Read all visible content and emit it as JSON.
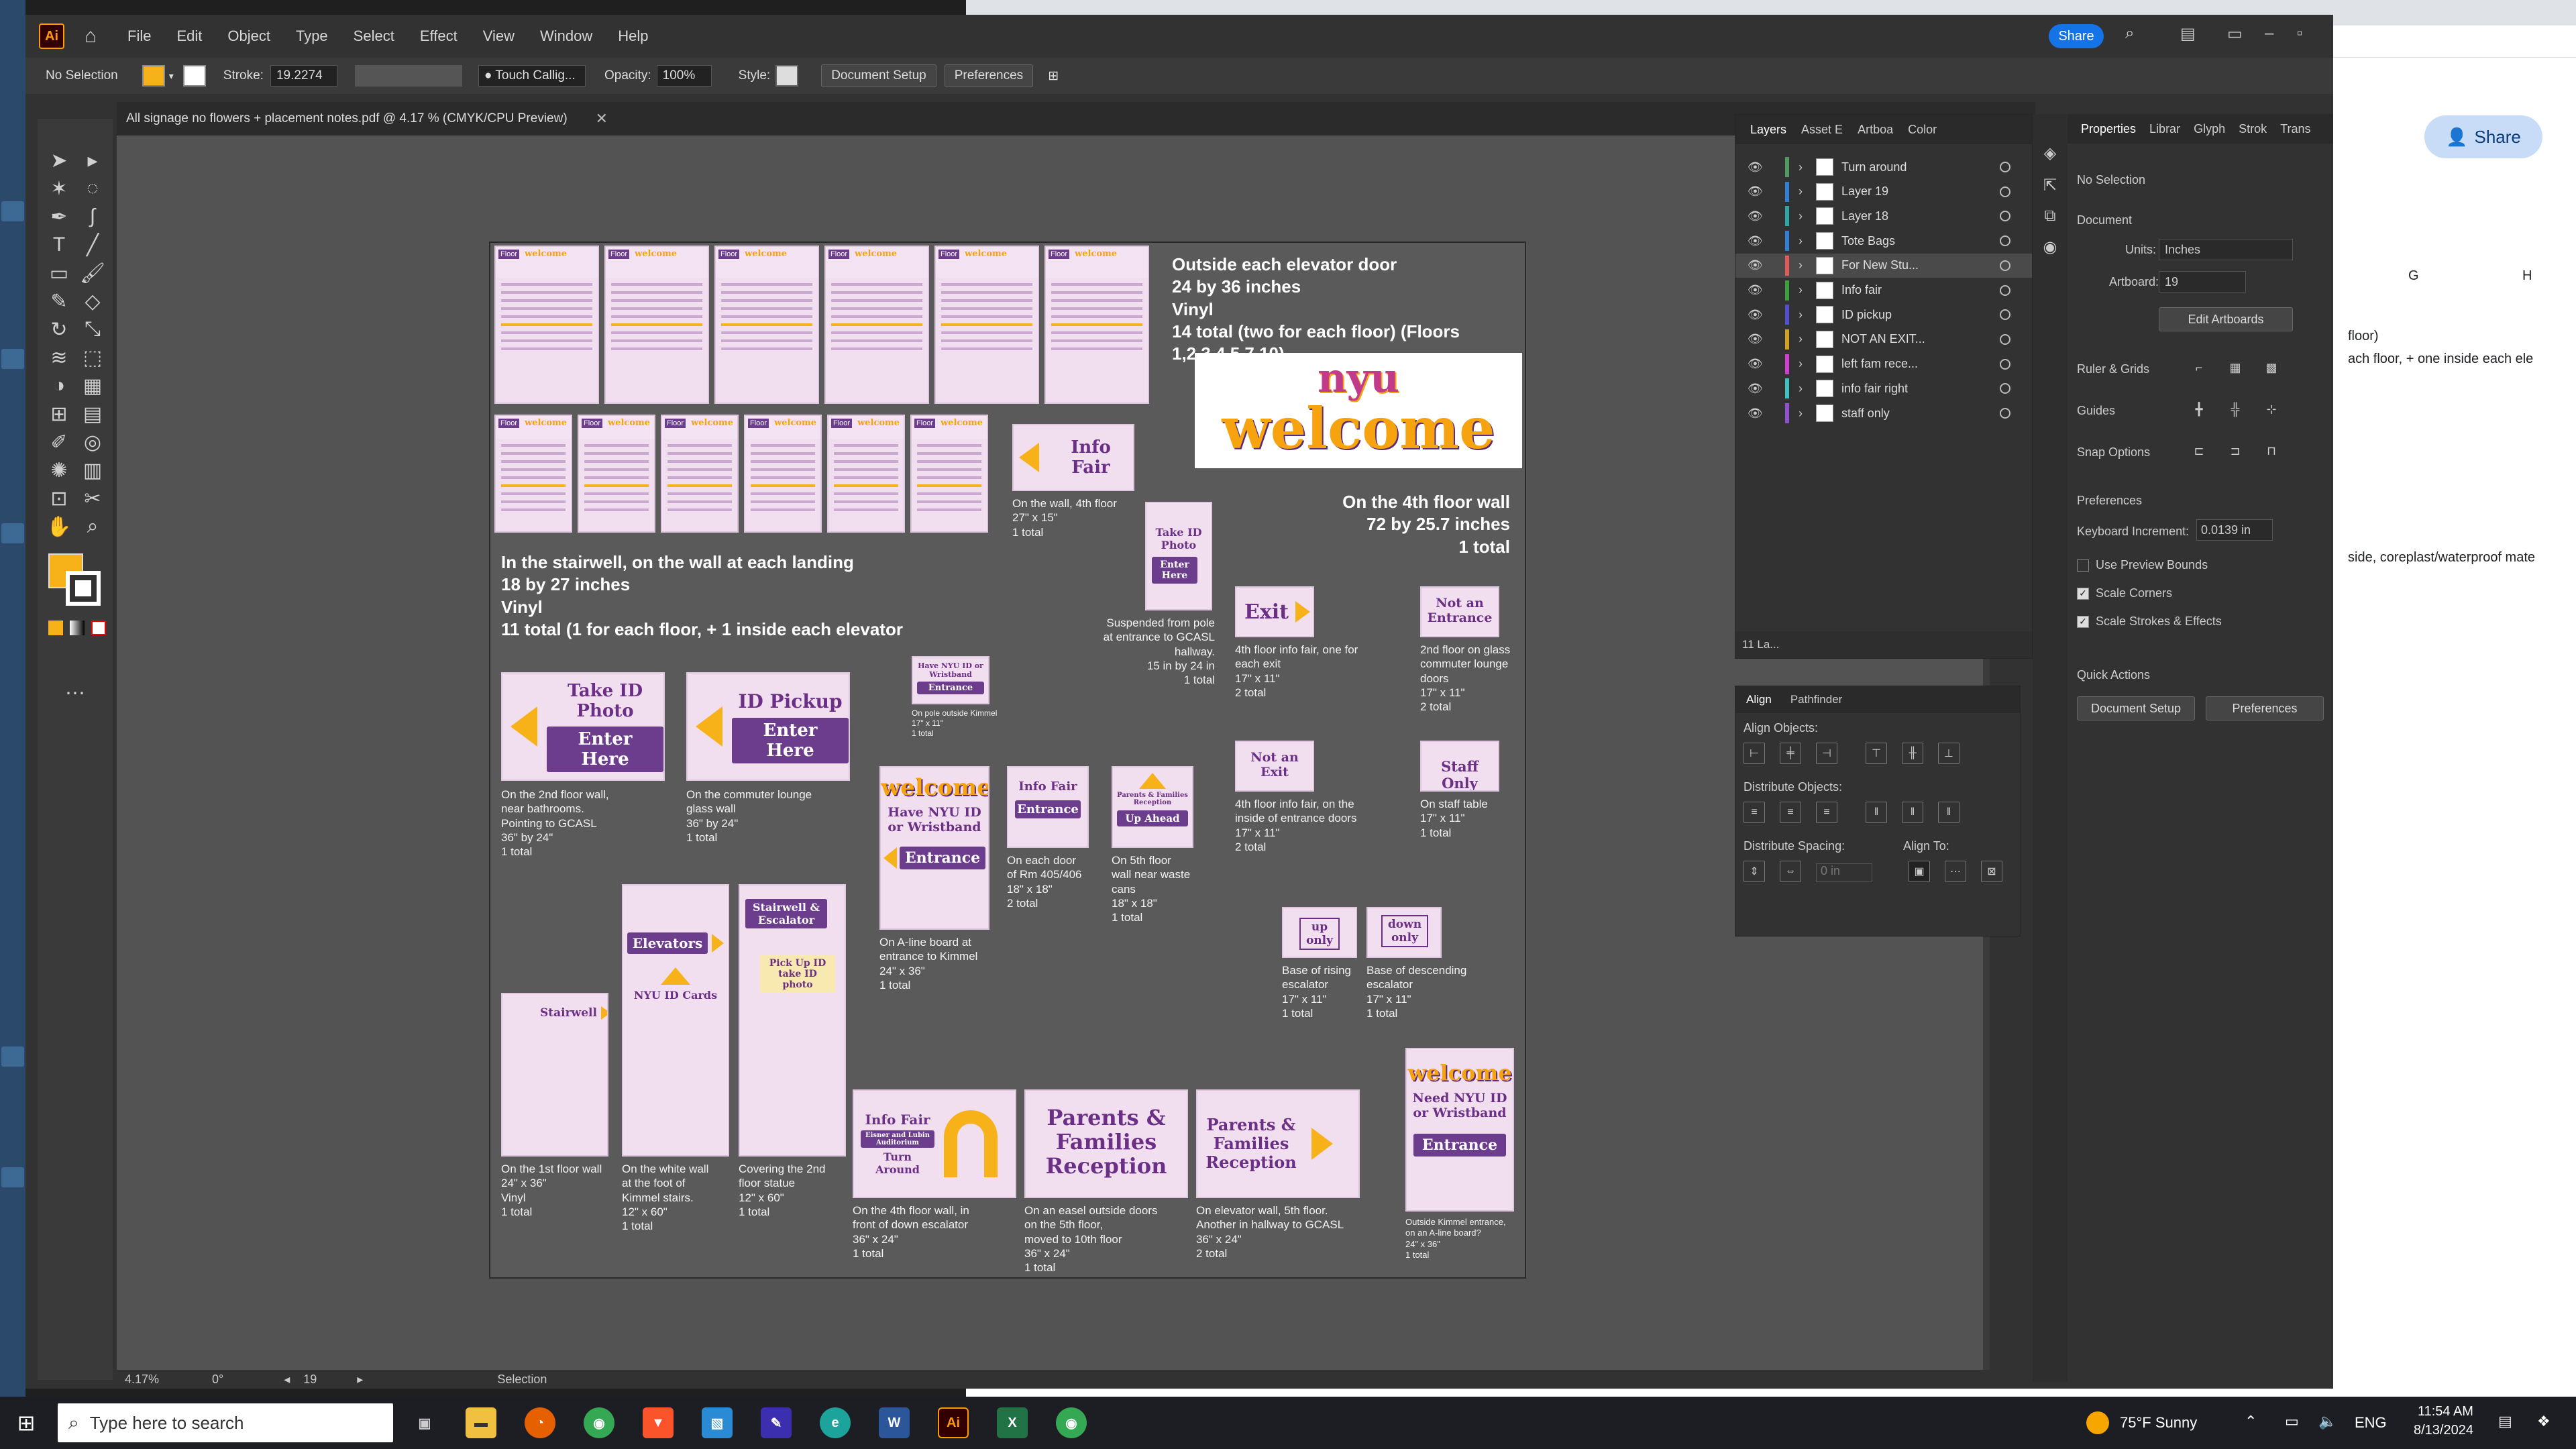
{
  "window": {
    "title": "All signage no flowers + placement notes.pdf @ 4.17 % (CMYK/CPU Preview)",
    "app_logo": "Ai",
    "share": "Share"
  },
  "menu": [
    "File",
    "Edit",
    "Object",
    "Type",
    "Select",
    "Effect",
    "View",
    "Window",
    "Help"
  ],
  "control": {
    "selection": "No Selection",
    "stroke_label": "Stroke:",
    "stroke_value": "19.2274",
    "brush": "Touch Callig...",
    "opacity_label": "Opacity:",
    "opacity_value": "100%",
    "style_label": "Style:",
    "doc_setup": "Document Setup",
    "preferences": "Preferences"
  },
  "status": {
    "zoom": "4.17%",
    "rotation": "0°",
    "artboard": "19",
    "tool": "Selection"
  },
  "artboard": {
    "elevator_note": [
      "Outside each elevator door",
      "24 by 36 inches",
      "Vinyl",
      "14 total (two for each floor) (Floors 1,2,3,4,5,7,10)"
    ],
    "stairwell_note": [
      "In the stairwell, on the wall at each landing",
      "18 by 27 inches",
      "Vinyl",
      "11 total (1 for each floor, + 1 inside each elevator"
    ],
    "fourth_floor_note": [
      "On the 4th floor wall",
      "72 by 25.7 inches",
      "1 total"
    ],
    "welcome_logo": [
      "nyu",
      "welcome"
    ],
    "floor_tile": "Floor",
    "signs": {
      "info_fair": "Info Fair",
      "take_id_photo": "Take ID Photo",
      "enter_here": "Enter Here",
      "id_pickup": "ID Pickup",
      "exit": "Exit",
      "not_an_entrance": "Not an Entrance",
      "not_an_exit": "Not an Exit",
      "staff_only": "Staff Only",
      "have_nyu_id": "Have NYU ID or Wristband",
      "entrance": "Entrance",
      "parents_up": "Parents & Families Reception",
      "up_ahead": "Up Ahead",
      "up_only": "up only",
      "down_only": "down only",
      "elevators": "Elevators",
      "nyu_id_cards": "NYU ID Cards",
      "stairwell": "Stairwell",
      "stairwell_escalator": "Stairwell & Escalator",
      "pick_up_id": "Pick Up ID",
      "take_id_photo_small": "take ID photo",
      "info_fair_turn": "Info Fair",
      "kimmel_aud": "Eisner and Lubin Auditorium",
      "turn_around": "Turn Around",
      "parents_families": "Parents & Families Reception",
      "need_nyu_id": "Need NYU ID or Wristband"
    },
    "notes": {
      "info_fair": [
        "On the wall, 4th floor",
        "27\" x 15\"",
        "1 total"
      ],
      "take_id_pole": [
        "Suspended from pole",
        "at entrance to GCASL",
        "hallway.",
        "15 in by 24 in",
        "1 total"
      ],
      "exit": [
        "4th floor info fair, one for",
        "each exit",
        "17\" x 11\"",
        "2 total"
      ],
      "not_entrance": [
        "2nd floor on glass",
        "commuter lounge",
        "doors",
        "17\" x 11\"",
        "2 total"
      ],
      "pole_kimmel": [
        "On pole outside Kimmel",
        "17\" x 11\"",
        "1 total"
      ],
      "take_id_2nd": [
        "On the 2nd floor wall,",
        "near bathrooms.",
        "Pointing to GCASL",
        "36\" by 24\"",
        "1 total"
      ],
      "id_pickup": [
        "On the commuter lounge",
        "glass wall",
        "36\" by 24\"",
        "1 total"
      ],
      "not_exit": [
        "4th floor info fair, on the",
        "inside of entrance doors",
        "17\" x 11\"",
        "2 total"
      ],
      "staff_only": [
        "On staff table",
        "17\" x 11\"",
        "1 total"
      ],
      "aline": [
        "On A-line board at",
        "entrance to Kimmel",
        "24\" x 36\"",
        "1 total"
      ],
      "info_fair_door": [
        "On each door",
        "of Rm 405/406",
        "18\" x 18\"",
        "2 total"
      ],
      "parents_5th": [
        "On 5th floor",
        "wall near waste",
        "cans",
        "18\" x 18\"",
        "1 total"
      ],
      "up_only": [
        "Base of rising",
        "escalator",
        "17\" x 11\"",
        "1 total"
      ],
      "down_only": [
        "Base of descending",
        "escalator",
        "17\" x 11\"",
        "1 total"
      ],
      "stairwell_1st": [
        "On the 1st floor wall",
        "24\" x 36\"",
        "Vinyl",
        "1 total"
      ],
      "elevators_wall": [
        "On the white wall",
        "at the foot of",
        "Kimmel stairs.",
        "12\" x 60\"",
        "1 total"
      ],
      "statue": [
        "Covering the 2nd",
        "floor statue",
        "12\" x 60\"",
        "1 total"
      ],
      "turn_around": [
        "On the 4th floor wall, in",
        "front of down escalator",
        "36\" x 24\"",
        "1 total"
      ],
      "easel": [
        "On an easel outside doors",
        "on the 5th floor,",
        "moved to 10th floor",
        "36\" x 24\"",
        "1 total"
      ],
      "elevator_wall": [
        "On elevator wall, 5th floor.",
        "Another in hallway to GCASL",
        "36\" x 24\"",
        "2 total"
      ],
      "kimmel_entrance": [
        "Outside Kimmel entrance,",
        "on an A-line board?",
        "24\" x 36\"",
        "1 total"
      ]
    }
  },
  "layers_panel": {
    "tabs": [
      "Layers",
      "Asset E",
      "Artboa",
      "Color"
    ],
    "items": [
      {
        "name": "Turn around",
        "color": "#4f9a5e"
      },
      {
        "name": "Layer 19",
        "color": "#2f7fd6"
      },
      {
        "name": "Layer 18",
        "color": "#2fa6a6"
      },
      {
        "name": "Tote Bags",
        "color": "#2f7fd6"
      },
      {
        "name": "For New Stu...",
        "color": "#e05a5a"
      },
      {
        "name": "Info fair",
        "color": "#3ba03b"
      },
      {
        "name": "ID pickup",
        "color": "#5050d0"
      },
      {
        "name": "NOT AN EXIT...",
        "color": "#d0a020"
      },
      {
        "name": "left fam rece...",
        "color": "#d040d0"
      },
      {
        "name": "info fair right",
        "color": "#40c0c0"
      },
      {
        "name": "staff only",
        "color": "#9050d0"
      }
    ],
    "footer": "11 La..."
  },
  "align_panel": {
    "tabs": [
      "Align",
      "Pathfinder"
    ],
    "align_objects": "Align Objects:",
    "distribute_objects": "Distribute Objects:",
    "distribute_spacing": "Distribute Spacing:",
    "align_to": "Align To:",
    "spacing": "0 in"
  },
  "properties": {
    "tabs": [
      "Properties",
      "Librar",
      "Glyph",
      "Strok",
      "Trans"
    ],
    "no_selection": "No Selection",
    "document": "Document",
    "units_label": "Units:",
    "units": "Inches",
    "artboard_label": "Artboard:",
    "artboard": "19",
    "edit_artboards": "Edit Artboards",
    "ruler_grids": "Ruler & Grids",
    "guides": "Guides",
    "snap": "Snap Options",
    "preferences_h": "Preferences",
    "kb_label": "Keyboard Increment:",
    "kb_value": "0.0139 in",
    "use_preview": "Use Preview Bounds",
    "scale_corners": "Scale Corners",
    "scale_strokes": "Scale Strokes & Effects",
    "quick_actions": "Quick Actions",
    "doc_setup": "Document Setup",
    "preferences": "Preferences"
  },
  "browser": {
    "share": "Share",
    "col_g": "G",
    "col_h": "H",
    "cell1": "floor)",
    "cell2": "ach floor, + one inside each ele",
    "cell3": "side, coreplast/waterproof mate"
  },
  "taskbar": {
    "search": "Type here to search",
    "weather": "75°F  Sunny",
    "lang": "ENG",
    "time": "11:54 AM",
    "date": "8/13/2024"
  },
  "colors": {
    "accent": "#f7b21a",
    "sign_bg": "#f1dff0",
    "purple": "#6b3d8c",
    "share_blue": "#1473e6"
  }
}
